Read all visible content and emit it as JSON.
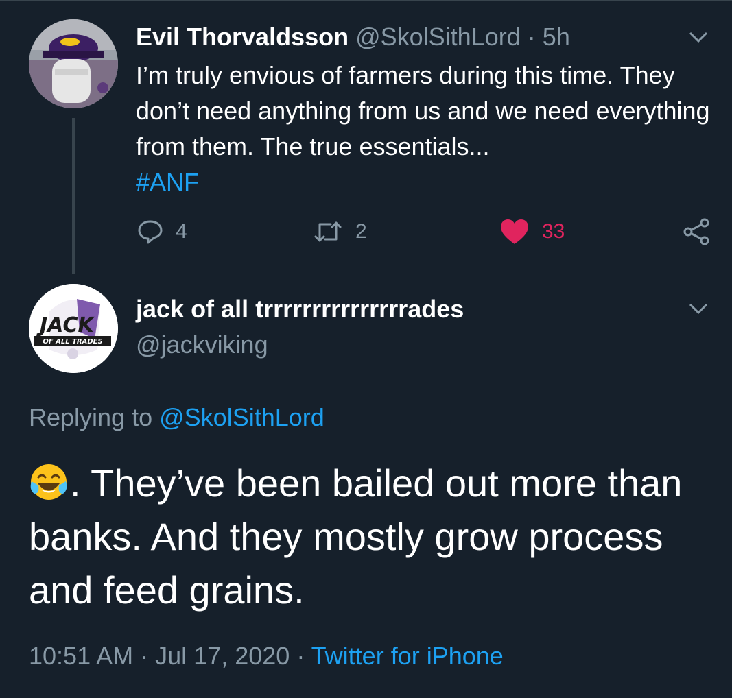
{
  "parent_tweet": {
    "display_name": "Evil Thorvaldsson",
    "handle": "@SkolSithLord",
    "separator": "·",
    "age": "5h",
    "text": "I’m truly envious of farmers during this time. They don’t need anything from us and we need everything from them. The true essentials...",
    "hashtag": "#ANF",
    "replies_count": "4",
    "retweets_count": "2",
    "likes_count": "33"
  },
  "reply_tweet": {
    "display_name": "jack of all trrrrrrrrrrrrrrrades",
    "handle": "@jackviking",
    "replying_prefix": "Replying to",
    "replying_handle": "@SkolSithLord",
    "emoji": "face-with-tears-of-joy",
    "text": ". They’ve been bailed out more than banks. And they mostly grow process and feed grains.",
    "time": "10:51 AM",
    "date_separator": "·",
    "date": "Jul 17, 2020",
    "source_separator": "·",
    "source": "Twitter for iPhone",
    "avatar_logo_text": "JACK",
    "avatar_logo_subtext": "OF ALL TRADES"
  },
  "colors": {
    "background": "#16202b",
    "secondary_text": "#8899a6",
    "link": "#1da1f2",
    "like": "#e0245e",
    "divider": "#38444d"
  }
}
